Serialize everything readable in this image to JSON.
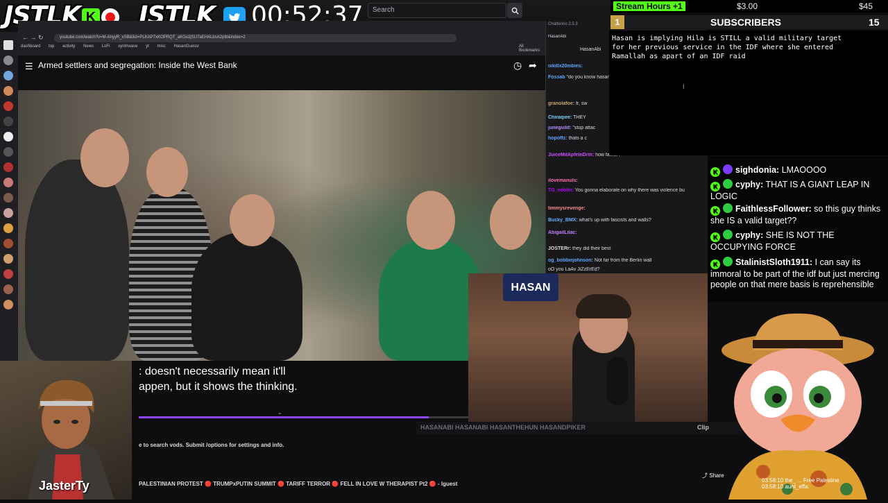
{
  "top_overlay": {
    "logo_left": "JSTLK",
    "kick_glyph": "K",
    "logo_right": "JSTLK_",
    "timer": "00:52:37",
    "search_placeholder": "Search",
    "colors": {
      "kick": "#53fc18",
      "twitter": "#1da1f2",
      "record": "#e91916"
    }
  },
  "browser": {
    "url": "youtube.com/watch?v=M-AhyyR_xSB&list=PLKAP7xKOPRQT_aKGu2jSU7aEHALbsA2ptb&index=2",
    "bookmarks": [
      "dashboard",
      "top",
      "activity",
      "News",
      "LoFi",
      "synthwave",
      "yt",
      "misc",
      "HasanGuessr"
    ],
    "all_bookmarks": "All Bookmarks"
  },
  "youtube": {
    "video_title": "Armed settlers and segregation: Inside the West Bank",
    "caption_line1": ": doesn't necessarily mean it'll",
    "caption_line2": "appen, but it shows the thinking.",
    "progress_fraction": 0.88,
    "chat_hint": "e to search vods. Submit /options for settings and info.",
    "stream_title": "PALESTINIAN PROTEST 🔴 TRUMPxPUTIN SUMMIT 🔴 TARIFF TERROR 🔴 FELL IN LOVE W THERAPIST Pt2 🔴 - lguest",
    "share_label": "Share"
  },
  "avatar": {
    "name": "JasterTy"
  },
  "chatterino": {
    "title": "Chatterino 2.5.3",
    "tab": "HasanAbi",
    "channel": "HasanAbi",
    "lines": [
      {
        "user": "ixkillx20mbies:",
        "text": "",
        "color": "#5aa9ff"
      },
      {
        "user": "Fossab",
        "text": "\"do you know hasan pike",
        "color": "#5aa9ff"
      },
      {
        "user": "granolafoe:",
        "text": "fr, sw",
        "color": "#c8a86a"
      },
      {
        "user": "Chiraqiee:",
        "text": "THEY",
        "color": "#7ad0ff"
      },
      {
        "user": "juneguild:",
        "text": "\"stop attac",
        "color": "#b48cff"
      },
      {
        "user": "hopoffz:",
        "text": "thats a c",
        "color": "#5aa9ff"
      },
      {
        "user": "JuiceMitApfelnDrin:",
        "text": "how father?",
        "color": "#d04cff"
      },
      {
        "user": "ilovemanuls:",
        "text": "",
        "color": "#ff6fb0"
      },
      {
        "user": "TG_ndolin:",
        "text": "You gonna elaborate on why there was violence bu",
        "color": "#b400ff"
      },
      {
        "user": "timmysrevenge:",
        "text": "",
        "color": "#ff8a8a"
      },
      {
        "user": "Bucky_BMX:",
        "text": "what's up with fascists and walls?",
        "color": "#60b0ff"
      },
      {
        "user": "AbigailLilac:",
        "text": "",
        "color": "#c080ff"
      },
      {
        "user": "JOSTERr:",
        "text": "they did their best",
        "color": "#dcdce0"
      },
      {
        "user": "og_bobbiejohnson:",
        "text": "Not far from the Berlin wall",
        "color": "#5aa9ff"
      },
      {
        "user": "",
        "text": "oO you LaAv JiZzErEd?",
        "color": "#dcdce0"
      }
    ]
  },
  "webcam": {
    "banner": "HASAN",
    "socials_strip": "HASANABI   HASANABI   HASANTHEHUN   HASANDPIKER",
    "clip_label": "Clip"
  },
  "donations": {
    "stream_hours_label": "Stream Hours +1",
    "amount_1": "$3.00",
    "amount_2": "$45",
    "subs_label": "SUBSCRIBERS",
    "subs_rank": "1",
    "subs_count": "15",
    "panel_text": "Hasan is implying Hila is STILL a valid military target\nfor her previous service in the IDF where she entered\nRamallah as apart of an IDF raid",
    "colors": {
      "gold": "#c7a14a",
      "subs_bar": "#1c1c1e"
    }
  },
  "chat_overlay": {
    "messages": [
      {
        "user": "sighdonia:",
        "text": "LMAOOOO",
        "role_color": "#7a3cff"
      },
      {
        "user": "cyphy:",
        "text": "THAT IS A GIANT LEAP IN LOGIC",
        "role_color": "#2ecc40"
      },
      {
        "user": "FaithlessFollower:",
        "text": "so this guy thinks she IS a valid target??",
        "role_color": "#2ecc40"
      },
      {
        "user": "cyphy:",
        "text": "SHE IS NOT THE OCCUPYING FORCE",
        "role_color": "#2ecc40"
      },
      {
        "user": "StalinistSloth1911:",
        "text": "I can say its immoral to be part of the idf but just mercing people on that mere basis is reprehensible",
        "role_color": "#2ecc40"
      }
    ]
  },
  "bottom_right_chat": {
    "line1": "03:58:10  the_  ... Free Palestine",
    "line2": "03:58:10  aunt_effa:"
  }
}
